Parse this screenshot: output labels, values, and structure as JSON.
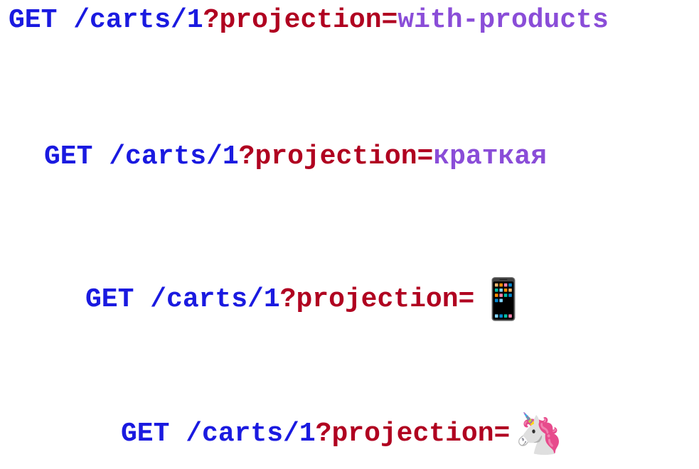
{
  "lines": [
    {
      "method": "GET ",
      "path": "/carts/1",
      "query": "?projection=",
      "value": "with-products",
      "valueIsEmoji": false
    },
    {
      "method": "GET ",
      "path": "/carts/1",
      "query": "?projection=",
      "value": "краткая",
      "valueIsEmoji": false
    },
    {
      "method": "GET ",
      "path": "/carts/1",
      "query": "?projection=",
      "value": "📱",
      "valueIsEmoji": true
    },
    {
      "method": "GET ",
      "path": "/carts/1",
      "query": "?projection=",
      "value": "🦄",
      "valueIsEmoji": true
    }
  ]
}
